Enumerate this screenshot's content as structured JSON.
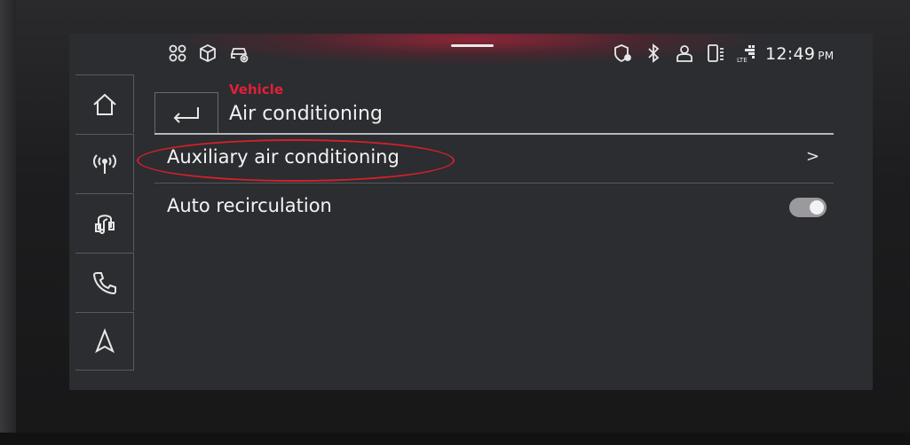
{
  "status_bar": {
    "time": "12:49",
    "ampm": "PM",
    "left_icons": [
      "apps-grid-icon",
      "package-icon",
      "car-settings-icon"
    ],
    "right_icons": [
      "location-shield-icon",
      "bluetooth-icon",
      "user-profile-icon",
      "phone-battery-icon",
      "lte-signal-icon"
    ]
  },
  "sidebar": {
    "items": [
      {
        "icon": "home-icon"
      },
      {
        "icon": "radio-antenna-icon"
      },
      {
        "icon": "media-music-icon"
      },
      {
        "icon": "phone-icon"
      },
      {
        "icon": "navigation-icon"
      }
    ]
  },
  "header": {
    "breadcrumb": "Vehicle",
    "title": "Air conditioning"
  },
  "list": {
    "items": [
      {
        "label": "Auxiliary air conditioning",
        "trailing": ">"
      },
      {
        "label": "Auto recirculation",
        "toggle_on": true
      }
    ]
  },
  "colors": {
    "accent_red": "#e0203a",
    "screen_bg": "#2b2d31",
    "text": "#f4f4f4"
  }
}
